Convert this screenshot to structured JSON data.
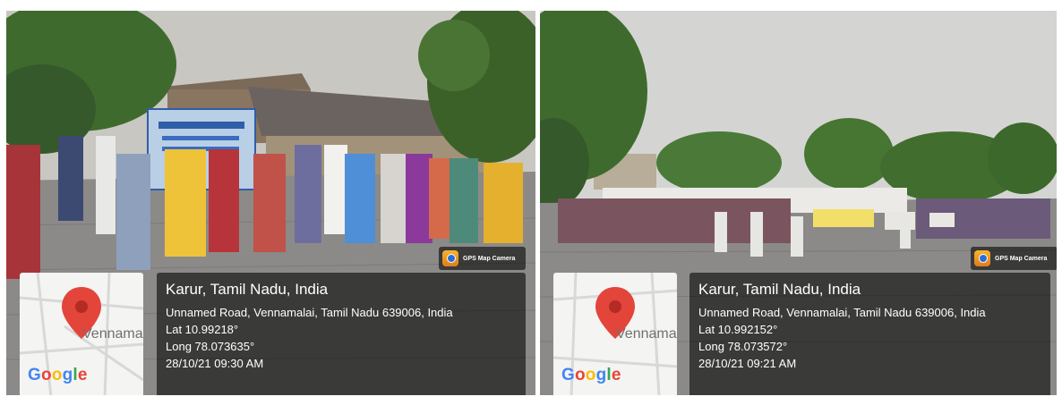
{
  "colors": {
    "sky_left": "#c9c7c2",
    "sky_right": "#d4d5d2",
    "pavement": "#8b8a88",
    "foliage": "#3f6a2e",
    "pin": "#e3453a",
    "panel": "rgba(0,0,0,0.58)"
  },
  "photos": [
    {
      "badge": "GPS Map Camera",
      "map_place": "Vennamalai",
      "google": [
        "G",
        "o",
        "o",
        "g",
        "l",
        "e"
      ],
      "title": "Karur, Tamil Nadu, India",
      "address": "Unnamed Road, Vennamalai, Tamil Nadu 639006, India",
      "lat": "Lat 10.99218°",
      "long": "Long 78.073635°",
      "datetime": "28/10/21 09:30 AM"
    },
    {
      "badge": "GPS Map Camera",
      "map_place": "Vennamalai",
      "google": [
        "G",
        "o",
        "o",
        "g",
        "l",
        "e"
      ],
      "title": "Karur, Tamil Nadu, India",
      "address": "Unnamed Road, Vennamalai, Tamil Nadu 639006, India",
      "lat": "Lat 10.992152°",
      "long": "Long 78.073572°",
      "datetime": "28/10/21 09:21 AM"
    }
  ],
  "icons": [
    "map-pin-icon",
    "gps-camera-icon"
  ]
}
